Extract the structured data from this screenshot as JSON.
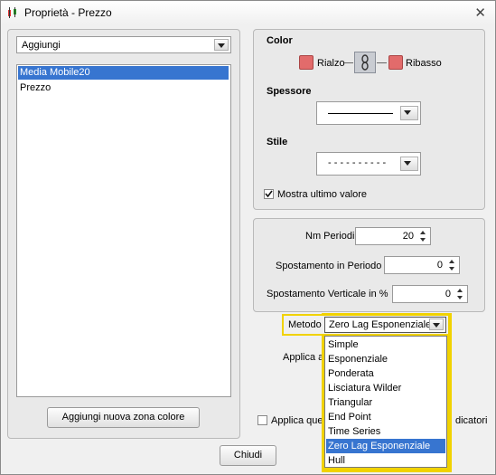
{
  "window": {
    "title": "Proprietà - Prezzo",
    "close_icon": "close-icon",
    "app_icon": "candlestick-icon"
  },
  "left": {
    "add_combo": {
      "value": "Aggiungi"
    },
    "list": [
      "Media Mobile20",
      "Prezzo"
    ],
    "selected_index": 0,
    "add_zone_button": "Aggiungi nuova zona colore"
  },
  "color_section": {
    "title": "Color",
    "rise_label": "Rialzo",
    "fall_label": "Ribasso",
    "rise_color": "#e26b6b",
    "fall_color": "#e26b6b",
    "link_icon": "chain-link-icon"
  },
  "thickness": {
    "title": "Spessore"
  },
  "style": {
    "title": "Stile",
    "dash_value": "- - - - - - - - - -"
  },
  "show_last": {
    "label": "Mostra ultimo valore",
    "checked": true
  },
  "params": {
    "periods_label": "Nm Periodi",
    "periods_value": "20",
    "shift_label": "Spostamento in Periodo",
    "shift_value": "0",
    "vshift_label": "Spostamento Verticale in %",
    "vshift_value": "0"
  },
  "method": {
    "label": "Metodo",
    "value": "Zero Lag Esponenziale",
    "options": [
      "Simple",
      "Esponenziale",
      "Ponderata",
      "Lisciatura Wilder",
      "Triangular",
      "End Point",
      "Time Series",
      "Zero Lag Esponenziale",
      "Hull"
    ],
    "selected_index": 7,
    "highlight_color": "#f1d200"
  },
  "apply": {
    "label_partial": "Applica a",
    "apply_all_partial": "Applica que",
    "apply_all_end": "dicatori"
  },
  "close_button": "Chiudi"
}
